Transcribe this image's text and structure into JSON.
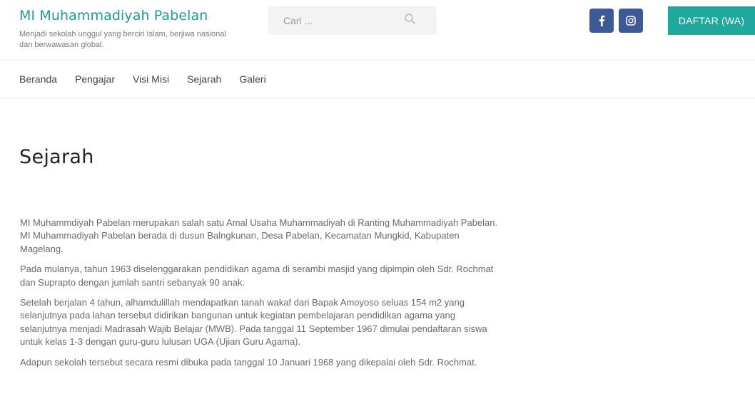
{
  "header": {
    "site_title": "MI Muhammadiyah Pabelan",
    "tagline": "Menjadi sekolah unggul yang berciri Islam, berjiwa nasional dan berwawasan global.",
    "search_placeholder": "Cari ...",
    "search_icon": "search-icon",
    "social": [
      {
        "name": "facebook-icon",
        "glyph": "f",
        "color": "#3b5a96"
      },
      {
        "name": "instagram-icon",
        "color": "#3b5a96"
      }
    ],
    "cta_label": "DAFTAR (WA)",
    "accent_color": "#1d9a91",
    "cta_color": "#1ea89e"
  },
  "nav": {
    "items": [
      "Beranda",
      "Pengajar",
      "Visi Misi",
      "Sejarah",
      "Galeri"
    ]
  },
  "main": {
    "title": "Sejarah",
    "paragraphs": [
      "MI Muhammdiyah Pabelan merupakan salah satu Amal Usaha Muhammadiyah di Ranting Muhammadiyah Pabelan. MI Muhammadiyah Pabelan berada di dusun Balngkunan, Desa Pabelan, Kecamatan Mungkid, Kabupaten Magelang.",
      "Pada mulanya, tahun 1963 diselenggarakan pendidikan agama di serambi masjid yang dipimpin oleh Sdr. Rochmat dan Suprapto dengan jumlah santri sebanyak 90 anak.",
      "Setelah berjalan 4 tahun, alhamdulillah mendapatkan tanah wakaf dari Bapak Amoyoso seluas 154 m2 yang selanjutnya pada lahan tersebut didirikan bangunan untuk kegiatan pembelajaran pendidikan agama yang selanjutnya menjadi Madrasah Wajib Belajar (MWB). Pada tanggal 11 September 1967 dimulai pendaftaran siswa untuk kelas 1-3 dengan guru-guru lulusan UGA (Ujian Guru Agama).",
      "Adapun sekolah tersebut secara resmi dibuka pada tanggal 10 Januari 1968 yang dikepalai oleh Sdr. Rochmat."
    ]
  }
}
